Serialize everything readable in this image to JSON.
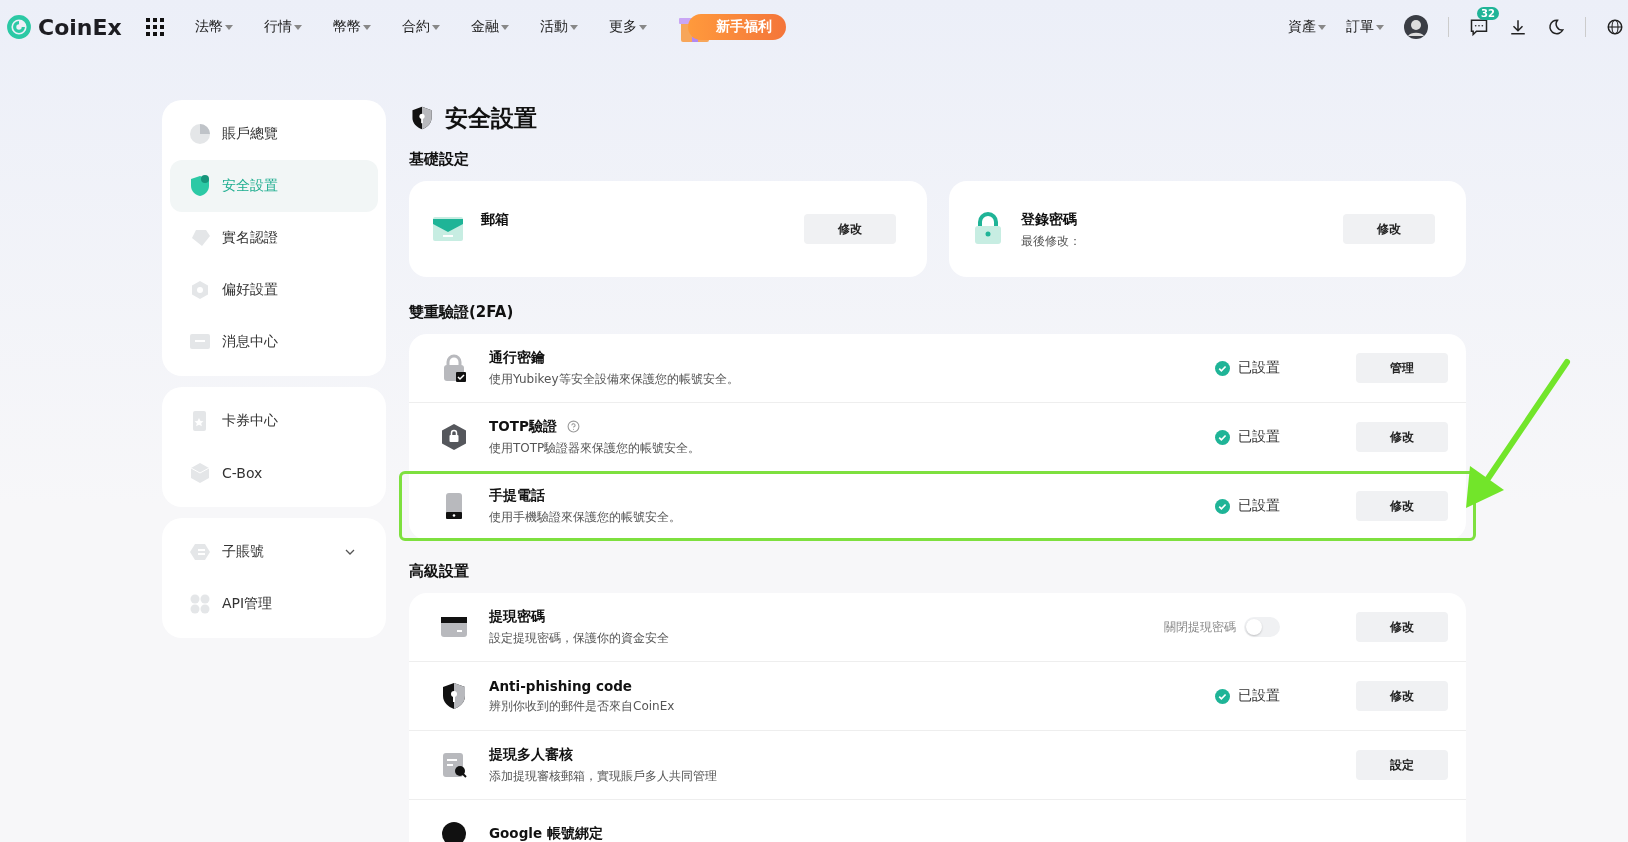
{
  "header": {
    "logo": "CoinEx",
    "nav": [
      "法幣",
      "行情",
      "幣幣",
      "合約",
      "金融",
      "活動",
      "更多"
    ],
    "promo": "新手福利",
    "right_menus": [
      "資產",
      "訂單"
    ],
    "message_count": "32"
  },
  "sidebar": {
    "groups": [
      [
        {
          "label": "賬戶總覽",
          "selected": false
        },
        {
          "label": "安全設置",
          "selected": true
        },
        {
          "label": "實名認證",
          "selected": false
        },
        {
          "label": "偏好設置",
          "selected": false
        },
        {
          "label": "消息中心",
          "selected": false
        }
      ],
      [
        {
          "label": "卡券中心",
          "selected": false
        },
        {
          "label": "C-Box",
          "selected": false
        }
      ],
      [
        {
          "label": "子賬號",
          "selected": false,
          "expanded": false
        },
        {
          "label": "API管理",
          "selected": false
        }
      ]
    ]
  },
  "page_title": "安全設置",
  "basic": {
    "title": "基礎設定",
    "cards": [
      {
        "name": "郵箱",
        "button": "修改"
      },
      {
        "name": "登錄密碼",
        "detail": "最後修改：",
        "button": "修改"
      }
    ]
  },
  "two_factor": {
    "title": "雙重驗證(2FA)",
    "rows": [
      {
        "kind": "status",
        "name": "通行密鑰",
        "description": "使用Yubikey等安全設備來保護您的帳號安全。",
        "status": "已設置",
        "button": "管理",
        "highlighted": false
      },
      {
        "kind": "status",
        "name": "TOTP驗證",
        "help": true,
        "description": "使用TOTP驗證器來保護您的帳號安全。",
        "status": "已設置",
        "button": "修改",
        "highlighted": false
      },
      {
        "kind": "status",
        "name": "手提電話",
        "description": "使用手機驗證來保護您的帳號安全。",
        "status": "已設置",
        "button": "修改",
        "highlighted": true
      }
    ]
  },
  "advanced": {
    "title": "高級設置",
    "rows": [
      {
        "kind": "toggle",
        "name": "提現密碼",
        "description": "設定提現密碼，保護你的資金安全",
        "toggle_label": "關閉提現密碼",
        "on": false,
        "button": "修改"
      },
      {
        "kind": "status",
        "name": "Anti-phishing code",
        "description": "辨別你收到的郵件是否來自CoinEx",
        "status": "已設置",
        "button": "修改"
      },
      {
        "kind": "plain",
        "name": "提現多人審核",
        "description": "添加提現審核郵箱，實現賬戶多人共同管理",
        "button": "設定"
      },
      {
        "kind": "plain",
        "name": "Google 帳號綁定"
      }
    ]
  }
}
